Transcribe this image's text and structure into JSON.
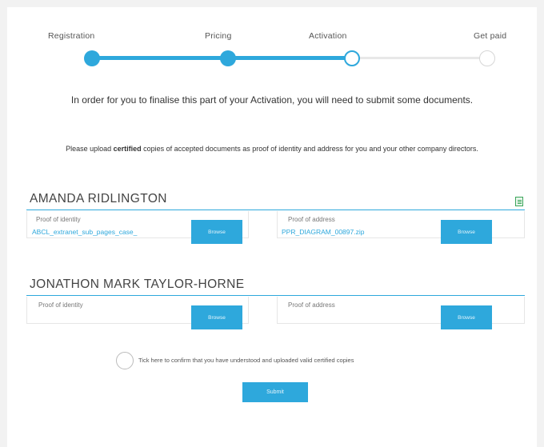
{
  "steps": [
    {
      "label": "Registration",
      "state": "done"
    },
    {
      "label": "Pricing",
      "state": "done"
    },
    {
      "label": "Activation",
      "state": "current"
    },
    {
      "label": "Get paid",
      "state": "upcoming"
    }
  ],
  "intro": "In order for you to finalise this part of your Activation, you will need to submit some documents.",
  "note": {
    "pre": "Please upload ",
    "bold": "certified",
    "post": " copies of accepted documents as proof of identity and address for you and your other company directors."
  },
  "directors": [
    {
      "name": "AMANDA RIDLINGTON",
      "identity_label": "Proof of identity",
      "identity_value": "ABCL_extranet_sub_pages_case_",
      "address_label": "Proof of address",
      "address_value": "PPR_DIAGRAM_00897.zip",
      "browse_label": "Browse"
    },
    {
      "name": "JONATHON MARK TAYLOR-HORNE",
      "identity_label": "Proof of identity",
      "identity_value": "",
      "address_label": "Proof of address",
      "address_value": "",
      "browse_label": "Browse"
    }
  ],
  "confirm_text": "Tick here to confirm that you have understood and uploaded valid certified copies",
  "submit_label": "Submit",
  "colors": {
    "accent": "#2ea8dc",
    "icon_green": "#3aa55a"
  }
}
